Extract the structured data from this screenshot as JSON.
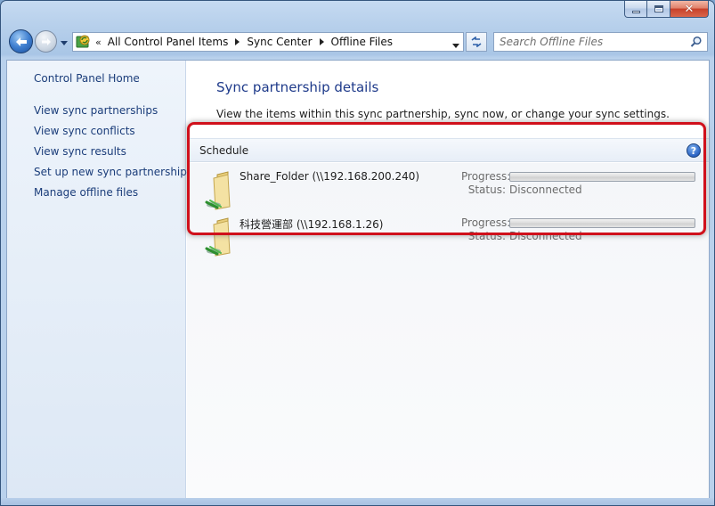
{
  "window": {
    "caption": {
      "minimize_icon": "minimize-icon",
      "maximize_icon": "maximize-icon",
      "close_icon": "close-icon",
      "close_glyph": "✕"
    }
  },
  "nav": {
    "address": {
      "chevrons": "«",
      "crumbs": [
        "All Control Panel Items",
        "Sync Center",
        "Offline Files"
      ]
    },
    "search": {
      "placeholder": "Search Offline Files"
    }
  },
  "sidebar": {
    "home": "Control Panel Home",
    "links": [
      "View sync partnerships",
      "View sync conflicts",
      "View sync results",
      "Set up new sync partnerships",
      "Manage offline files"
    ]
  },
  "main": {
    "title": "Sync partnership details",
    "description": "View the items within this sync partnership, sync now, or change your sync settings.",
    "toolbar": {
      "schedule": "Schedule",
      "help": "?"
    },
    "partnerships": [
      {
        "name": "Share_Folder (\\\\192.168.200.240)",
        "progress_label": "Progress:",
        "progress": 0,
        "status_label": "Status:",
        "status": "Disconnected"
      },
      {
        "name": "科技營運部 (\\\\192.168.1.26)",
        "progress_label": "Progress:",
        "progress": 0,
        "status_label": "Status:",
        "status": "Disconnected"
      }
    ]
  },
  "colors": {
    "link": "#1b3d7a",
    "title": "#1e3a8a",
    "highlight": "#d0101b"
  }
}
